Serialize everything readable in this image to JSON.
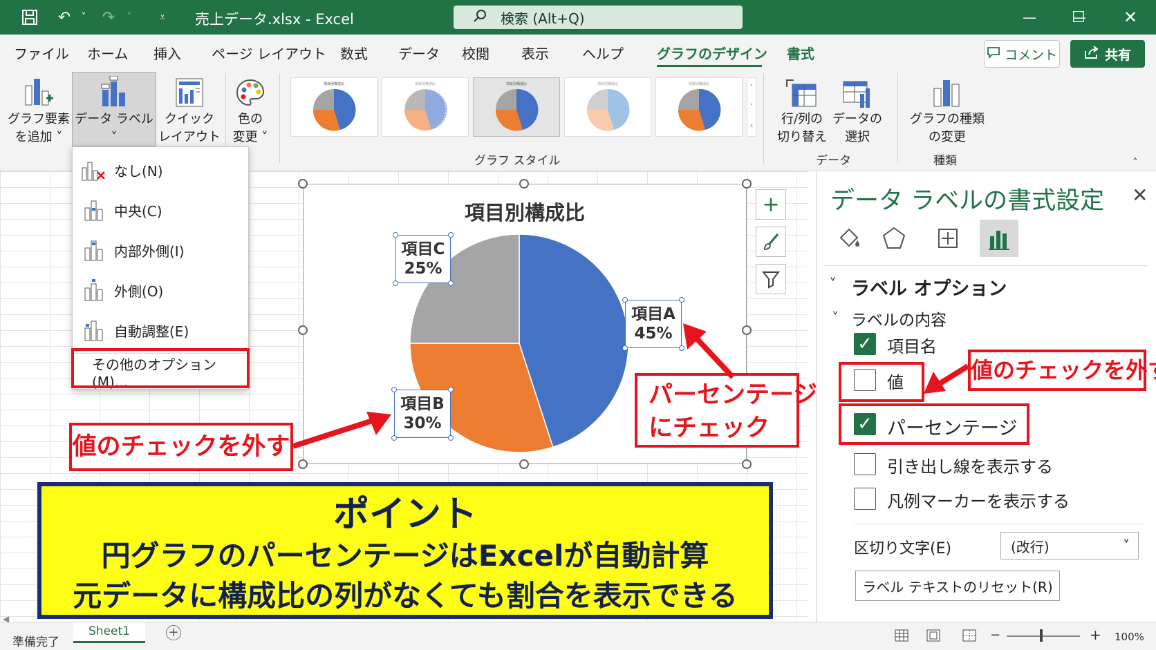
{
  "titlebar": {
    "doc_title": "売上データ.xlsx  -  Excel",
    "search_placeholder": "検索 (Alt+Q)",
    "save_icon": "save-icon",
    "undo_icon": "undo-icon",
    "redo_icon": "redo-icon"
  },
  "menu": {
    "tabs": [
      "ファイル",
      "ホーム",
      "挿入",
      "ページ レイアウト",
      "数式",
      "データ",
      "校閲",
      "表示",
      "ヘルプ",
      "グラフのデザイン",
      "書式"
    ],
    "active_tab": "グラフのデザイン",
    "comment_label": "コメント",
    "share_label": "共有"
  },
  "ribbon": {
    "add_element": [
      "グラフ要素",
      "を追加 ˅"
    ],
    "data_label": "データ ラベル ˅",
    "quick_layout": [
      "クイック",
      "レイアウト ˅"
    ],
    "change_color": [
      "色の",
      "変更 ˅"
    ],
    "switch_row_col": [
      "行/列の",
      "切り替え"
    ],
    "select_data": [
      "データの",
      "選択"
    ],
    "change_type": [
      "グラフの種類",
      "の変更"
    ],
    "groups": {
      "style": "グラフ スタイル",
      "data": "データ",
      "type": "種類"
    }
  },
  "dropdown": {
    "items": [
      "なし(N)",
      "中央(C)",
      "内部外側(I)",
      "外側(O)",
      "自動調整(E)"
    ],
    "more": "その他のオプション(M)..."
  },
  "chart_data": {
    "type": "pie",
    "title": "項目別構成比",
    "categories": [
      "項目A",
      "項目B",
      "項目C"
    ],
    "values": [
      45,
      30,
      25
    ],
    "labels": [
      [
        "項目A",
        "45%"
      ],
      [
        "項目B",
        "30%"
      ],
      [
        "項目C",
        "25%"
      ]
    ],
    "colors": [
      "#4472c4",
      "#ed7d31",
      "#a5a5a5"
    ]
  },
  "callouts": {
    "left": "値のチェックを外す",
    "middle": [
      "パーセンテージ",
      "にチェック"
    ],
    "right": "値のチェックを外す"
  },
  "point": {
    "heading": "ポイント",
    "line1": "円グラフのパーセンテージはExcelが自動計算",
    "line2": "元データに構成比の列がなくても割合を表示できる"
  },
  "pane": {
    "title": "データ ラベルの書式設定",
    "section": "ラベル オプション",
    "subsection": "ラベルの内容",
    "options": [
      {
        "label": "項目名",
        "checked": true
      },
      {
        "label": "値",
        "checked": false
      },
      {
        "label": "パーセンテージ",
        "checked": true
      },
      {
        "label": "引き出し線を表示する",
        "checked": false
      },
      {
        "label": "凡例マーカーを表示する",
        "checked": false
      }
    ],
    "separator_label": "区切り文字(E)",
    "separator_value": "(改行)",
    "reset_label": "ラベル テキストのリセット(R)"
  },
  "status": {
    "ready": "準備完了",
    "sheet_tab": "Sheet1",
    "zoom": "100%"
  }
}
